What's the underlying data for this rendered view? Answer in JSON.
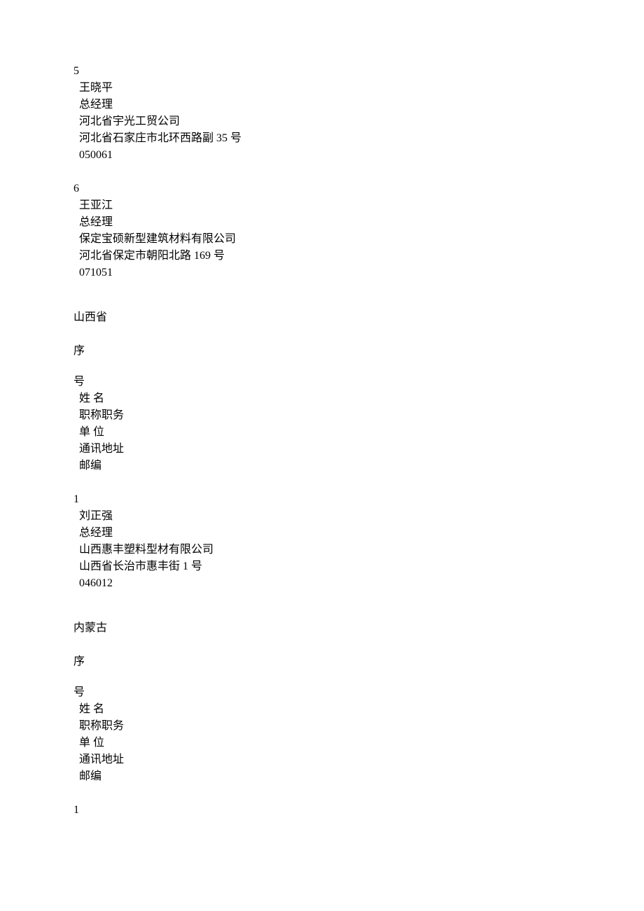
{
  "entries_top": [
    {
      "num": "5",
      "name": "王晓平",
      "title": "总经理",
      "org": "河北省宇光工贸公司",
      "addr": "河北省石家庄市北环西路副 35 号",
      "postcode": "050061"
    },
    {
      "num": "6",
      "name": "王亚江",
      "title": "总经理",
      "org": "保定宝硕新型建筑材料有限公司",
      "addr": "河北省保定市朝阳北路 169 号",
      "postcode": "071051"
    }
  ],
  "sections": [
    {
      "title": "山西省",
      "header": {
        "xu": "序",
        "hao": "号",
        "name": "姓    名",
        "title": "职称职务",
        "org": "单        位",
        "addr": "通讯地址",
        "postcode": "邮编"
      },
      "entries": [
        {
          "num": "1",
          "name": "刘正强",
          "title": "总经理",
          "org": "山西惠丰塑料型材有限公司",
          "addr": "山西省长治市惠丰街 1 号",
          "postcode": "046012"
        }
      ]
    },
    {
      "title": "内蒙古",
      "header": {
        "xu": "序",
        "hao": "号",
        "name": "姓    名",
        "title": "职称职务",
        "org": "单        位",
        "addr": "通讯地址",
        "postcode": "邮编"
      },
      "entries": [
        {
          "num": "1"
        }
      ]
    }
  ]
}
